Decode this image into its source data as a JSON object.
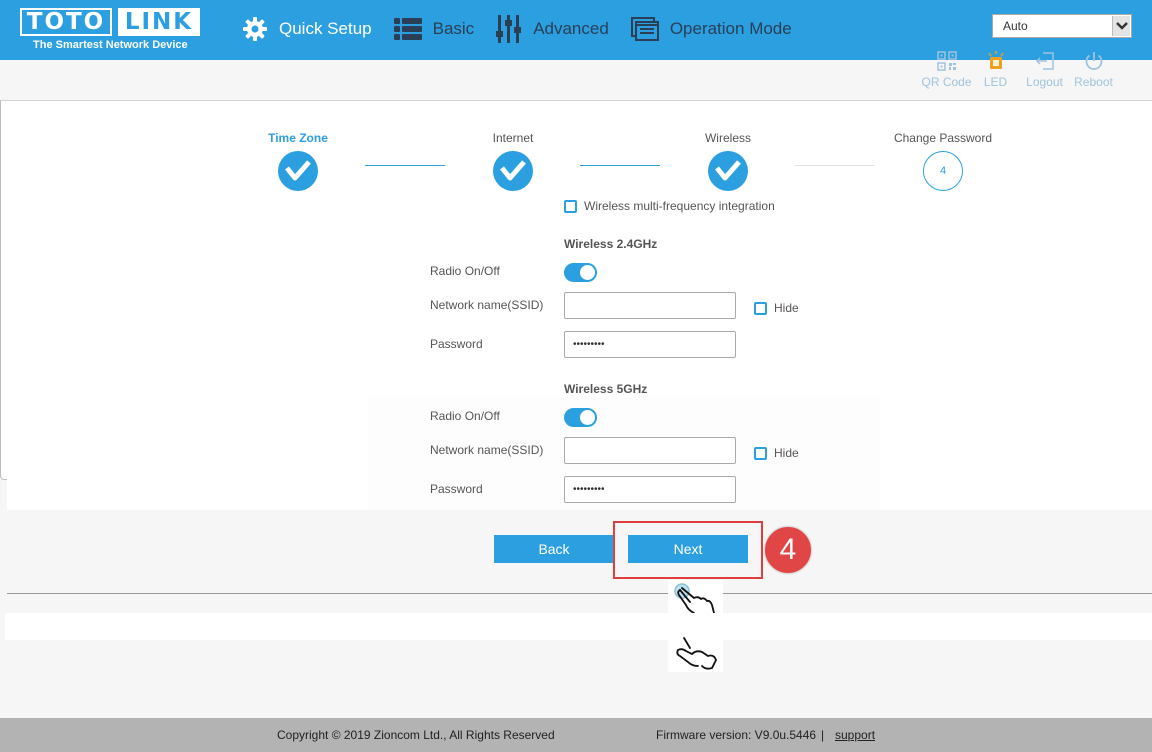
{
  "brand": {
    "name_left": "TOTO",
    "name_right": "LINK",
    "tagline": "The Smartest Network Device"
  },
  "nav": [
    {
      "label": "Quick Setup",
      "icon": "gear-icon"
    },
    {
      "label": "Basic",
      "icon": "list-icon"
    },
    {
      "label": "Advanced",
      "icon": "sliders-icon"
    },
    {
      "label": "Operation Mode",
      "icon": "window-icon"
    }
  ],
  "language": {
    "selected": "Auto"
  },
  "tools": [
    {
      "label": "QR Code",
      "icon": "qr-code-icon"
    },
    {
      "label": "LED",
      "icon": "led-icon"
    },
    {
      "label": "Logout",
      "icon": "logout-icon"
    },
    {
      "label": "Reboot",
      "icon": "power-icon"
    }
  ],
  "steps": [
    {
      "label": "Time Zone",
      "state": "done"
    },
    {
      "label": "Internet",
      "state": "done"
    },
    {
      "label": "Wireless",
      "state": "done"
    },
    {
      "label": "Change Password",
      "state": "todo",
      "number": "4"
    }
  ],
  "multi_freq_label": "Wireless multi-frequency integration",
  "band24": {
    "title": "Wireless 2.4GHz",
    "radio_label": "Radio On/Off",
    "ssid_label": "Network name(SSID)",
    "ssid_value": "",
    "hide_label": "Hide",
    "password_label": "Password",
    "password_value": "•••••••••"
  },
  "band5": {
    "title": "Wireless 5GHz",
    "radio_label": "Radio On/Off",
    "ssid_label": "Network name(SSID)",
    "ssid_value": "",
    "hide_label": "Hide",
    "password_label": "Password",
    "password_value": "•••••••••"
  },
  "buttons": {
    "back": "Back",
    "next": "Next"
  },
  "annotation": {
    "step_number": "4"
  },
  "footer": {
    "copyright": "Copyright © 2019 Zioncom Ltd., All Rights Reserved",
    "firmware": "Firmware version: V9.0u.5446",
    "separator": "|",
    "support": "support"
  },
  "colors": {
    "accent": "#2b9fe0",
    "highlight": "#e03d3d",
    "footer": "#b3b3b3"
  }
}
